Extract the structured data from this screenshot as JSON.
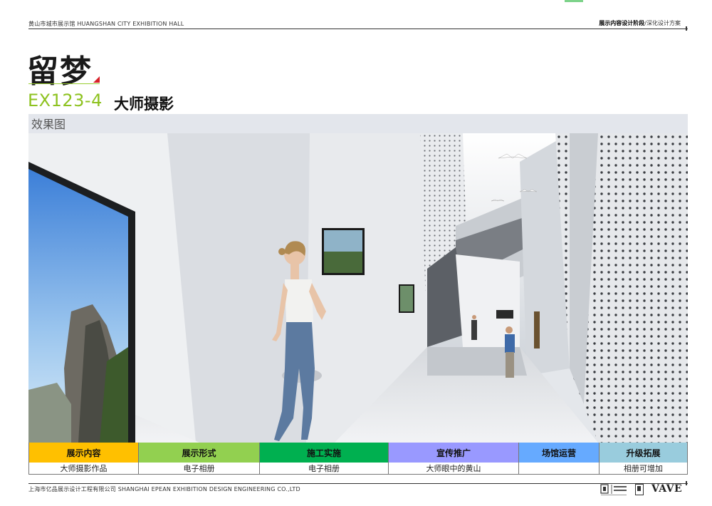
{
  "header": {
    "project_title": "黄山市城市展示馆 HUANGSHAN CITY EXHIBITION HALL",
    "stage_bold": "展示内容设计阶段",
    "stage_rest": "/深化设计方案"
  },
  "section": {
    "title": "留梦"
  },
  "exhibit": {
    "code": "EX123-4",
    "name": "大师摄影"
  },
  "render": {
    "label": "效果图"
  },
  "table": {
    "headers": [
      "展示内容",
      "展示形式",
      "施工实施",
      "宣传推广",
      "场馆运营",
      "升级拓展"
    ],
    "header_colors": [
      "#ffc000",
      "#92d050",
      "#00b050",
      "#9999ff",
      "#66aaff",
      "#99ccdd"
    ],
    "cells": [
      "大师摄影作品",
      "电子相册",
      "电子相册",
      "大师眼中的黄山",
      "",
      "相册可增加"
    ]
  },
  "footer": {
    "company": "上海市亿品展示设计工程有限公司 SHANGHAI EPEAN EXHIBITION DESIGN ENGINEERING CO.,LTD",
    "logo_vave": "VAVE"
  }
}
